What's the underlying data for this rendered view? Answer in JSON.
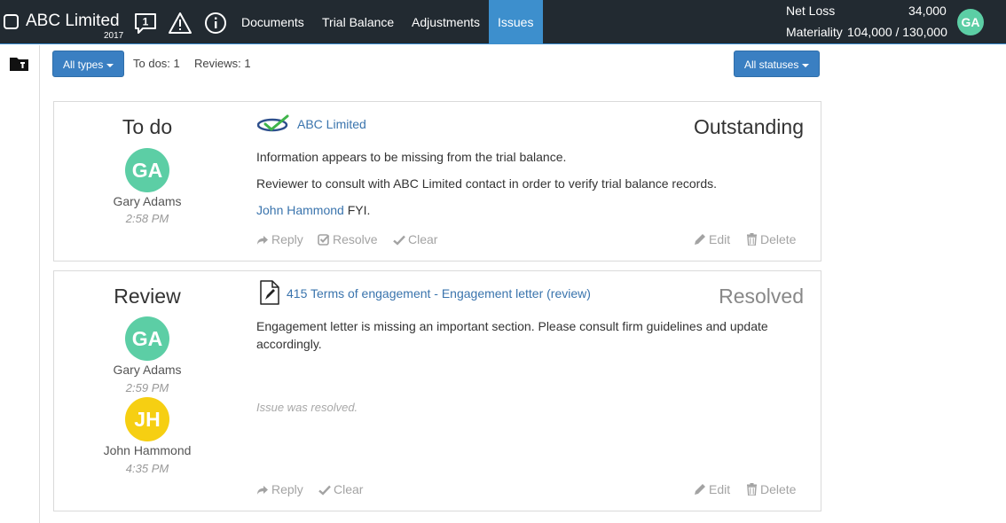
{
  "header": {
    "company": "ABC Limited",
    "year": "2017",
    "notification_count": "1",
    "nav": [
      "Documents",
      "Trial Balance",
      "Adjustments",
      "Issues"
    ],
    "active_nav": "Issues",
    "net_loss_label": "Net Loss",
    "net_loss_value": "34,000",
    "materiality_label": "Materiality",
    "materiality_value": "104,000 / 130,000",
    "user_initials": "GA"
  },
  "toolbar": {
    "type_filter": "All types",
    "todos": "To dos: 1",
    "reviews": "Reviews: 1",
    "status_filter": "All statuses"
  },
  "issues": [
    {
      "type": "To do",
      "status": "Outstanding",
      "status_color": "#333333",
      "link_title": "ABC Limited",
      "link_icon": "company-logo",
      "text1": "Information appears to be missing from the trial balance.",
      "text2": "Reviewer to consult with ABC Limited contact in order to verify trial balance records.",
      "mention": "John Hammond",
      "mention_suffix": " FYI.",
      "people": [
        {
          "initials": "GA",
          "name": "Gary Adams",
          "time": "2:58 PM",
          "color": "#5ccea5"
        }
      ],
      "actions": {
        "reply": "Reply",
        "resolve": "Resolve",
        "clear": "Clear",
        "edit": "Edit",
        "delete": "Delete"
      }
    },
    {
      "type": "Review",
      "status": "Resolved",
      "status_color": "#888888",
      "link_title": "415 Terms of engagement - Engagement letter (review)",
      "link_icon": "document-edit-icon",
      "text1": "Engagement letter is missing an important section. Please consult firm guidelines and update accordingly.",
      "note": "Issue was resolved.",
      "people": [
        {
          "initials": "GA",
          "name": "Gary Adams",
          "time": "2:59 PM",
          "color": "#5ccea5"
        },
        {
          "initials": "JH",
          "name": "John Hammond",
          "time": "4:35 PM",
          "color": "#f6cf12"
        }
      ],
      "actions": {
        "reply": "Reply",
        "clear": "Clear",
        "edit": "Edit",
        "delete": "Delete"
      }
    }
  ]
}
